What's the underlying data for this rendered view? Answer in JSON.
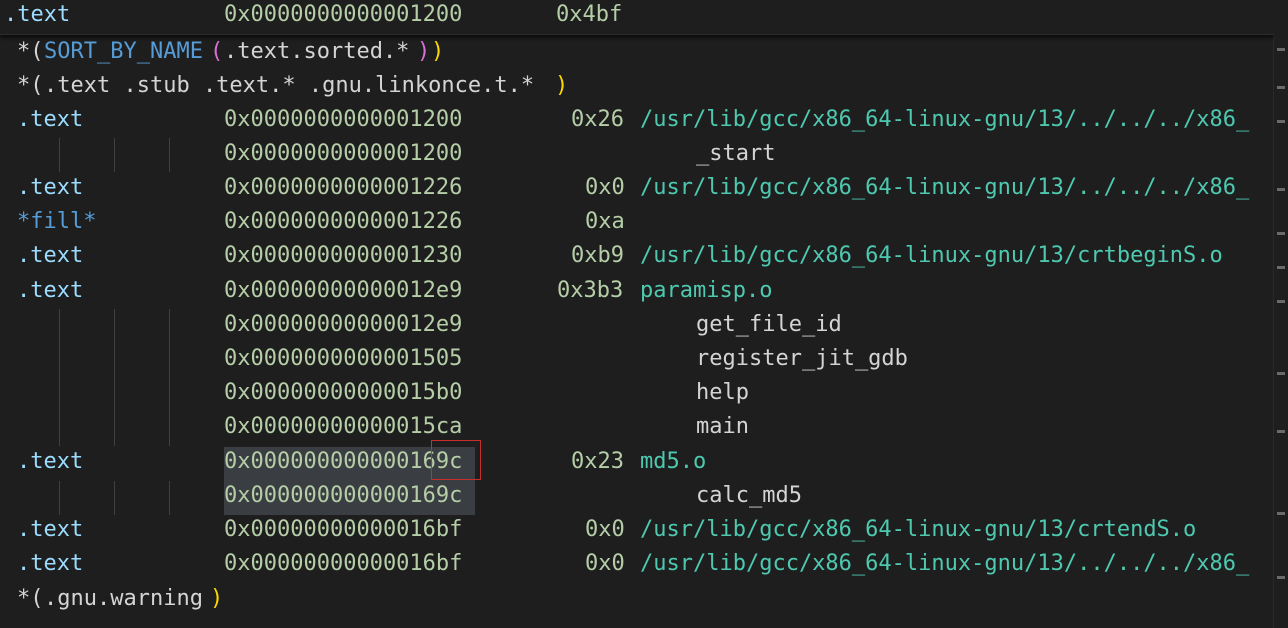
{
  "sticky_line": {
    "section": ".text",
    "address": "0x0000000000001200",
    "size": "0x4bf"
  },
  "lines": [
    {
      "type": "pattern1",
      "prefix": "*(",
      "keyword": "SORT_BY_NAME",
      "open": "(",
      "arg": ".text.sorted.*",
      "close1": ")",
      "close2": ")"
    },
    {
      "type": "pattern2",
      "prefix": "*(",
      "arg": ".text .stub .text.* .gnu.linkonce.t.*",
      "close": ")"
    },
    {
      "section": ".text",
      "address": "0x0000000000001200",
      "size": "0x26",
      "file": "/usr/lib/gcc/x86_64-linux-gnu/13/../../../x86_"
    },
    {
      "address": "0x0000000000001200",
      "symbol": "_start"
    },
    {
      "section": ".text",
      "address": "0x0000000000001226",
      "size": "0x0",
      "file": "/usr/lib/gcc/x86_64-linux-gnu/13/../../../x86_"
    },
    {
      "section": "*fill*",
      "address": "0x0000000000001226",
      "size": "0xa"
    },
    {
      "section": ".text",
      "address": "0x0000000000001230",
      "size": "0xb9",
      "file": "/usr/lib/gcc/x86_64-linux-gnu/13/crtbeginS.o"
    },
    {
      "section": ".text",
      "address": "0x00000000000012e9",
      "size": "0x3b3",
      "file": "paramisp.o"
    },
    {
      "address": "0x00000000000012e9",
      "symbol": "get_file_id"
    },
    {
      "address": "0x0000000000001505",
      "symbol": "register_jit_gdb"
    },
    {
      "address": "0x00000000000015b0",
      "symbol": "help"
    },
    {
      "address": "0x00000000000015ca",
      "symbol": "main"
    },
    {
      "section": ".text",
      "address": "0x000000000000169c",
      "size": "0x23",
      "file": "md5.o"
    },
    {
      "address": "0x000000000000169c",
      "symbol": "calc_md5"
    },
    {
      "section": ".text",
      "address": "0x00000000000016bf",
      "size": "0x0",
      "file": "/usr/lib/gcc/x86_64-linux-gnu/13/crtendS.o"
    },
    {
      "section": ".text",
      "address": "0x00000000000016bf",
      "size": "0x0",
      "file": "/usr/lib/gcc/x86_64-linux-gnu/13/../../../x86_"
    },
    {
      "type": "pattern3",
      "prefix": "*(",
      "arg": ".gnu.warning",
      "close": ")"
    }
  ],
  "colors": {
    "background": "#1e1e1e",
    "section": "#9cdcfe",
    "fill": "#569cd6",
    "number": "#b5cea8",
    "path": "#4ec9b0",
    "highlight": "#3a3d41",
    "cursor_box": "#c72e2e"
  }
}
